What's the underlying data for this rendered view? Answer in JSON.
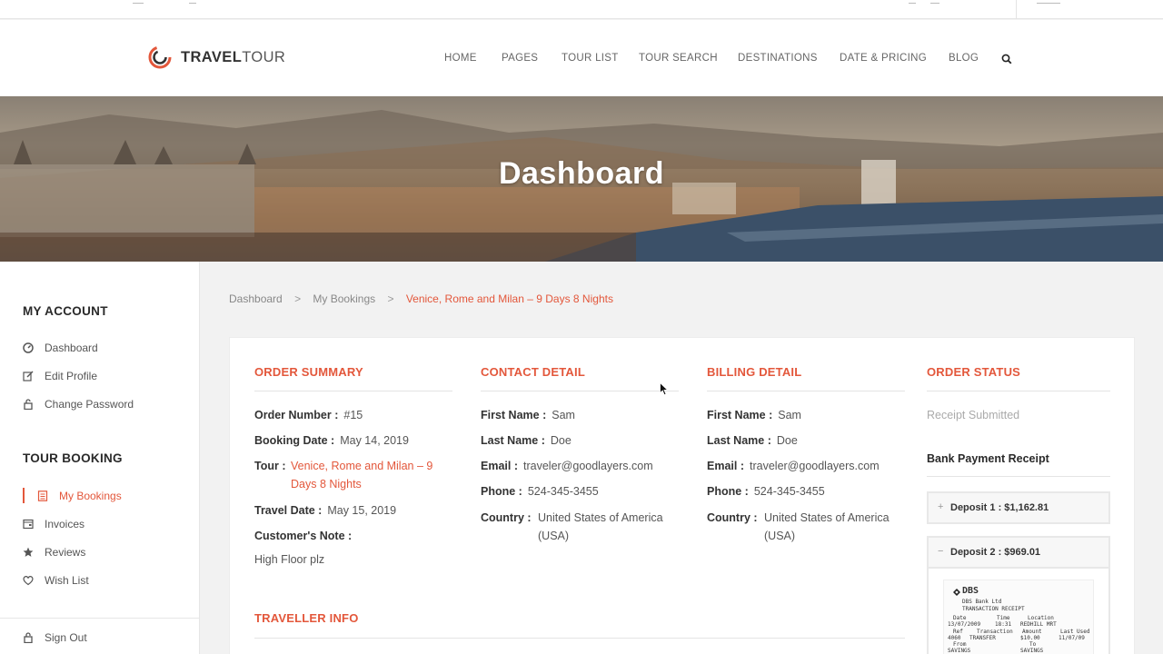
{
  "brand": {
    "name_bold": "TRAVEL",
    "name_light": "TOUR"
  },
  "nav": {
    "items": [
      {
        "label": "HOME"
      },
      {
        "label": "PAGES"
      },
      {
        "label": "TOUR LIST"
      },
      {
        "label": "TOUR SEARCH"
      },
      {
        "label": "DESTINATIONS"
      },
      {
        "label": "DATE & PRICING"
      },
      {
        "label": "BLOG"
      }
    ],
    "search_icon": "search-icon"
  },
  "banner": {
    "title": "Dashboard"
  },
  "sidebar": {
    "account_heading": "MY ACCOUNT",
    "account_items": [
      {
        "label": "Dashboard",
        "icon": "dashboard-icon"
      },
      {
        "label": "Edit Profile",
        "icon": "edit-icon"
      },
      {
        "label": "Change Password",
        "icon": "lock-icon"
      }
    ],
    "booking_heading": "TOUR BOOKING",
    "booking_items": [
      {
        "label": "My Bookings",
        "icon": "document-icon",
        "active": true
      },
      {
        "label": "Invoices",
        "icon": "invoice-icon"
      },
      {
        "label": "Reviews",
        "icon": "star-icon"
      },
      {
        "label": "Wish List",
        "icon": "heart-icon"
      }
    ],
    "sign_out": {
      "label": "Sign Out",
      "icon": "sign-out-icon"
    }
  },
  "breadcrumb": {
    "items": [
      "Dashboard",
      "My Bookings"
    ],
    "separator": ">",
    "current": "Venice, Rome and Milan – 9 Days 8 Nights"
  },
  "order_summary": {
    "title": "ORDER SUMMARY",
    "order_number_label": "Order Number :",
    "order_number": "#15",
    "booking_date_label": "Booking Date :",
    "booking_date": "May 14, 2019",
    "tour_label": "Tour :",
    "tour_line1": "Venice, Rome and Milan – 9",
    "tour_line2": "Days 8 Nights",
    "travel_date_label": "Travel Date :",
    "travel_date": "May 15, 2019",
    "note_label": "Customer's Note :",
    "note": "High Floor plz"
  },
  "contact_detail": {
    "title": "CONTACT DETAIL",
    "first_name_label": "First Name :",
    "first_name": "Sam",
    "last_name_label": "Last Name :",
    "last_name": "Doe",
    "email_label": "Email :",
    "email": "traveler@goodlayers.com",
    "phone_label": "Phone :",
    "phone": "524-345-3455",
    "country_label": "Country :",
    "country_line1": "United States of America",
    "country_line2": "(USA)"
  },
  "billing_detail": {
    "title": "BILLING DETAIL",
    "first_name_label": "First Name :",
    "first_name": "Sam",
    "last_name_label": "Last Name :",
    "last_name": "Doe",
    "email_label": "Email :",
    "email": "traveler@goodlayers.com",
    "phone_label": "Phone :",
    "phone": "524-345-3455",
    "country_label": "Country :",
    "country_line1": "United States of America",
    "country_line2": "(USA)"
  },
  "order_status": {
    "title": "ORDER STATUS",
    "status": "Receipt Submitted",
    "bank_receipt_title": "Bank Payment Receipt",
    "deposits": [
      {
        "sign": "+",
        "label": "Deposit 1 : $1,162.81",
        "expanded": false
      },
      {
        "sign": "−",
        "label": "Deposit 2 : $969.01",
        "expanded": true
      }
    ],
    "receipt": {
      "bank": "DBS",
      "bank_sub": "DBS Bank Ltd",
      "heading": "TRANSACTION RECEIPT",
      "row1_labels": [
        "Date",
        "Time",
        "Location"
      ],
      "row1_values": [
        "13/07/2009",
        "18:31",
        "REDHILL MRT"
      ],
      "row2_labels": [
        "Ref",
        "Transaction",
        "Amount",
        "Last Used"
      ],
      "row2_values": [
        "4060",
        "TRANSFER",
        "$10.00",
        "11/07/09"
      ],
      "row3_labels": [
        "From",
        "To"
      ],
      "row3_values": [
        "SAVINGS",
        "SAVINGS"
      ]
    }
  },
  "traveller_info": {
    "title": "TRAVELLER INFO"
  },
  "colors": {
    "accent": "#e3573b",
    "heading": "#2a2a2a",
    "muted": "#aaaaaa"
  }
}
